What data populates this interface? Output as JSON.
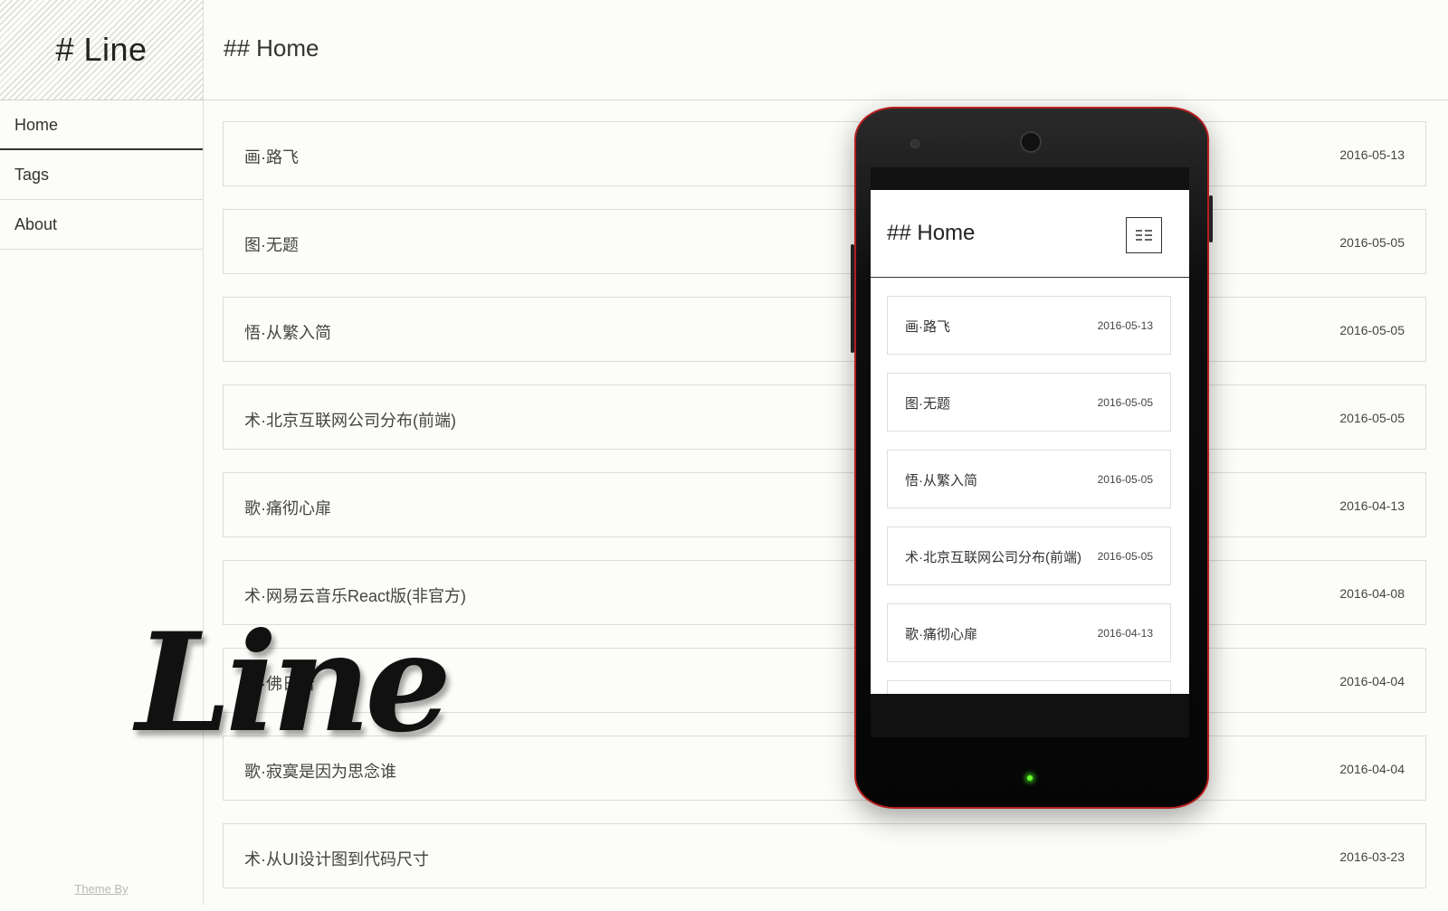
{
  "logo": {
    "text": "# Line"
  },
  "nav": [
    {
      "label": "Home"
    },
    {
      "label": "Tags"
    },
    {
      "label": "About"
    }
  ],
  "footer": {
    "theme_by": "Theme By"
  },
  "header": {
    "title": "## Home"
  },
  "posts": [
    {
      "title": "画·路飞",
      "date": "2016-05-13"
    },
    {
      "title": "图·无题",
      "date": "2016-05-05"
    },
    {
      "title": "悟·从繁入简",
      "date": "2016-05-05"
    },
    {
      "title": "术·北京互联网公司分布(前端)",
      "date": "2016-05-05"
    },
    {
      "title": "歌·痛彻心扉",
      "date": "2016-04-13"
    },
    {
      "title": "术·网易云音乐React版(非官方)",
      "date": "2016-04-08"
    },
    {
      "title": "吾·佛日若",
      "date": "2016-04-04"
    },
    {
      "title": "歌·寂寞是因为思念谁",
      "date": "2016-04-04"
    },
    {
      "title": "术·从UI设计图到代码尺寸",
      "date": "2016-03-23"
    }
  ],
  "overlay": {
    "script_logo": "Line"
  },
  "mobile": {
    "title": "## Home",
    "menu_icon": "menu-icon",
    "posts": [
      {
        "title": "画·路飞",
        "date": "2016-05-13"
      },
      {
        "title": "图·无题",
        "date": "2016-05-05"
      },
      {
        "title": "悟·从繁入简",
        "date": "2016-05-05"
      },
      {
        "title": "术·北京互联网公司分布(前端)",
        "date": "2016-05-05"
      },
      {
        "title": "歌·痛彻心扉",
        "date": "2016-04-13"
      }
    ]
  },
  "colors": {
    "background": "#fcfcf8",
    "phone_frame": "#b51e1e",
    "led": "#6cff2c"
  }
}
